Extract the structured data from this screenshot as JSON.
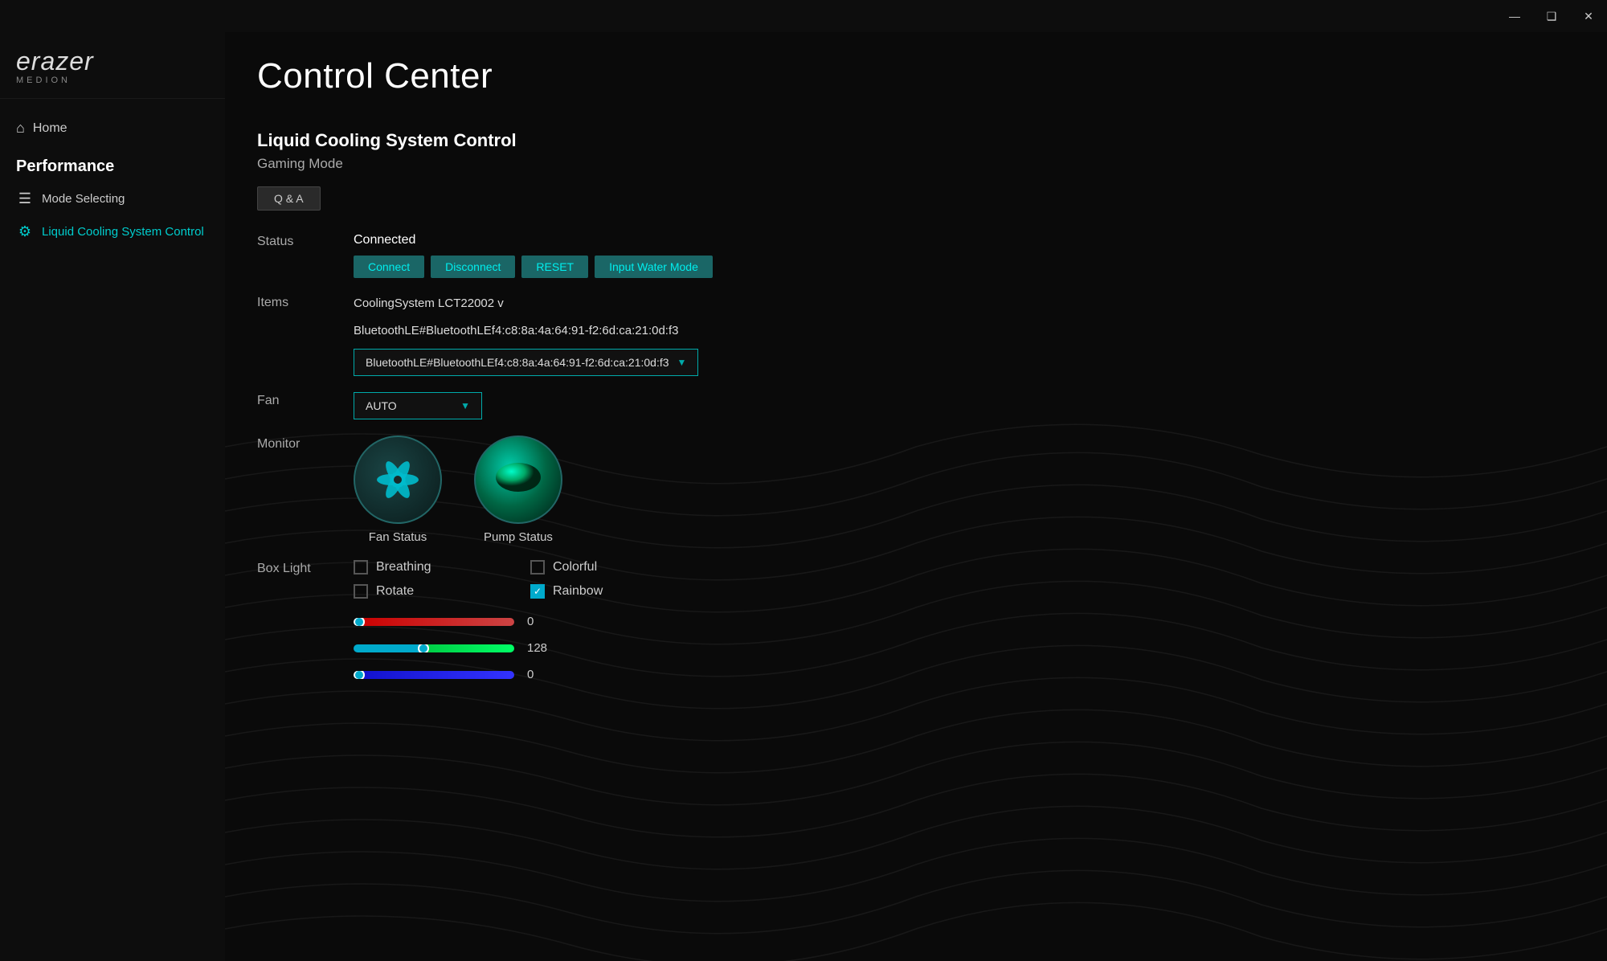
{
  "titlebar": {
    "minimize_label": "—",
    "maximize_label": "❑",
    "close_label": "✕"
  },
  "logo": {
    "brand": "erazer",
    "sub": "MEDION"
  },
  "sidebar": {
    "home_label": "Home",
    "section_label": "Performance",
    "nav_items": [
      {
        "id": "mode-selecting",
        "label": "Mode Selecting",
        "icon": "≡"
      },
      {
        "id": "liquid-cooling",
        "label": "Liquid Cooling System Control",
        "icon": "⚙"
      }
    ]
  },
  "header": {
    "title": "Control Center"
  },
  "page": {
    "section_title": "Liquid Cooling System Control",
    "mode_text": "Gaming Mode",
    "qa_label": "Q & A",
    "status_label": "Status",
    "status_value": "Connected",
    "btn_connect": "Connect",
    "btn_disconnect": "Disconnect",
    "btn_reset": "RESET",
    "btn_input_water": "Input Water Mode",
    "items_label": "Items",
    "items_line1": "CoolingSystem LCT22002 v",
    "items_line2": "BluetoothLE#BluetoothLEf4:c8:8a:4a:64:91-f2:6d:ca:21:0d:f3",
    "dropdown_value": "BluetoothLE#BluetoothLEf4:c8:8a:4a:64:91-f2:6d:ca:21:0d:f3",
    "fan_label": "Fan",
    "fan_value": "AUTO",
    "monitor_label": "Monitor",
    "fan_status_label": "Fan Status",
    "pump_status_label": "Pump Status",
    "box_light_label": "Box Light",
    "checkboxes": [
      {
        "id": "breathing",
        "label": "Breathing",
        "checked": false
      },
      {
        "id": "colorful",
        "label": "Colorful",
        "checked": false
      },
      {
        "id": "rotate",
        "label": "Rotate",
        "checked": false
      },
      {
        "id": "rainbow",
        "label": "Rainbow",
        "checked": true
      }
    ],
    "sliders": [
      {
        "id": "red",
        "value": "0",
        "percent": 2
      },
      {
        "id": "green",
        "value": "128",
        "percent": 42
      },
      {
        "id": "blue",
        "value": "0",
        "percent": 2
      }
    ]
  }
}
